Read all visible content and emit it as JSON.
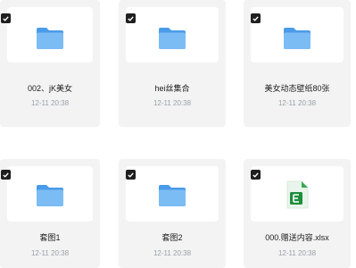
{
  "files": [
    {
      "name": "002、jK美女",
      "date": "12-11 20:38",
      "type": "folder-icon"
    },
    {
      "name": "hei丝集合",
      "date": "12-11 20:38",
      "type": "folder-icon"
    },
    {
      "name": "美女动态壁纸80张",
      "date": "12-11 20:38",
      "type": "folder-icon"
    },
    {
      "name": "套图1",
      "date": "12-11 20:38",
      "type": "folder-icon"
    },
    {
      "name": "套图2",
      "date": "12-11 20:38",
      "type": "folder-icon"
    },
    {
      "name": "000.赠送内容.xlsx",
      "date": "12-11 20:38",
      "type": "excel-file-icon"
    }
  ],
  "colors": {
    "card_bg": "#f3f3f4",
    "folder": "#5aa9f0",
    "excel": "#1e8e3e",
    "date_text": "#9aa0a6"
  }
}
